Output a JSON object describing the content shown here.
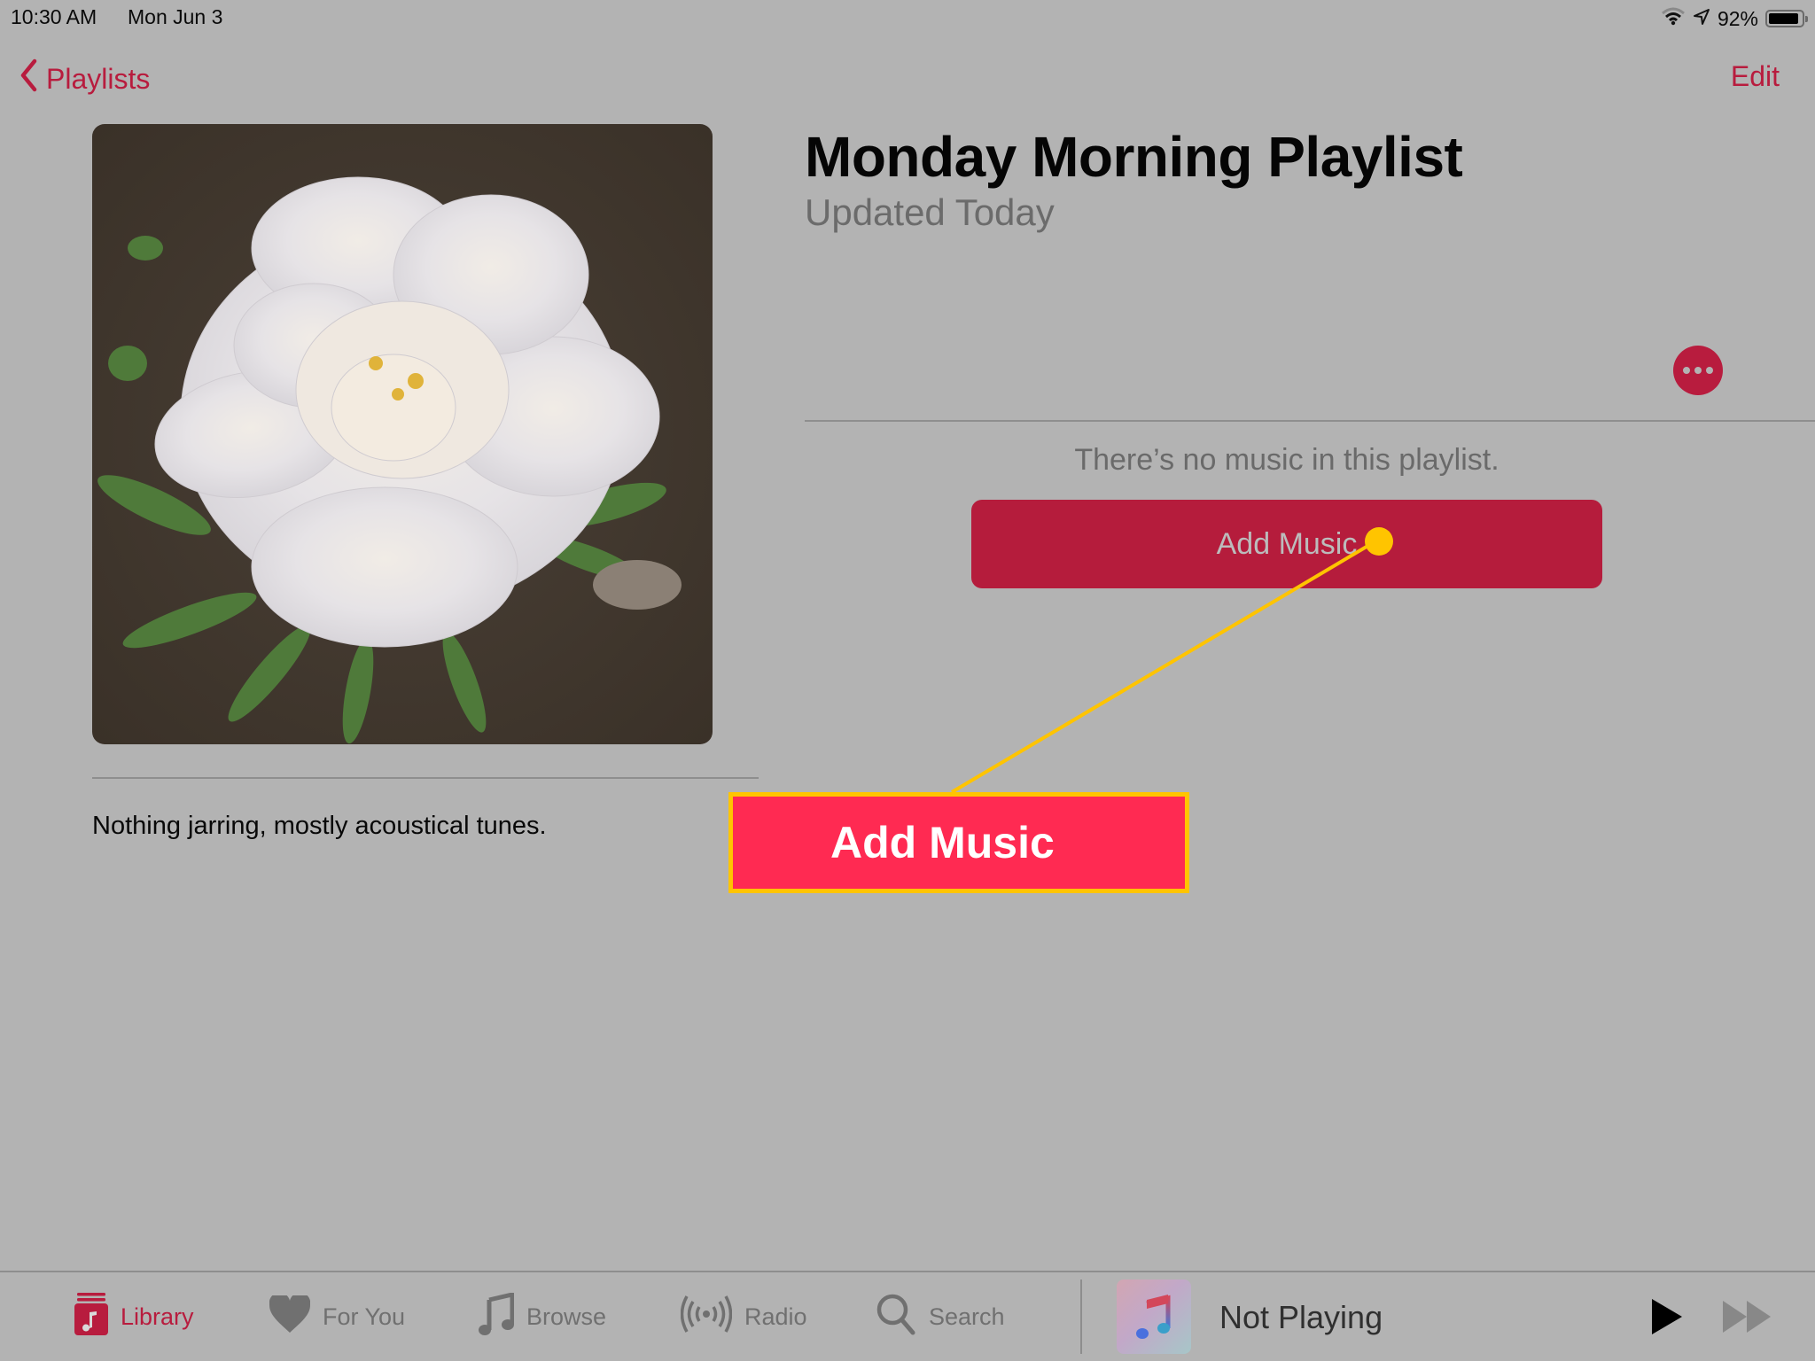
{
  "status_bar": {
    "time": "10:30 AM",
    "date": "Mon Jun 3",
    "battery_percent": "92%",
    "battery_level": 0.92,
    "icons": [
      "wifi-icon",
      "location-arrow-icon",
      "battery-icon"
    ]
  },
  "nav": {
    "back_label": "Playlists",
    "edit_label": "Edit"
  },
  "playlist": {
    "title": "Monday Morning Playlist",
    "subtitle": "Updated Today",
    "artwork": "white peony flower photo",
    "description": "Nothing jarring, mostly acoustical tunes.",
    "empty_message": "There’s no music in this playlist.",
    "add_music_label": "Add Music"
  },
  "annotation": {
    "label": "Add Music",
    "colors": {
      "fill": "#ff2a52",
      "border": "#ffc400",
      "pointer": "#ffc400"
    }
  },
  "tabbar": {
    "tabs": [
      {
        "label": "Library",
        "icon": "library-icon",
        "active": true
      },
      {
        "label": "For You",
        "icon": "heart-icon",
        "active": false
      },
      {
        "label": "Browse",
        "icon": "music-note-icon",
        "active": false
      },
      {
        "label": "Radio",
        "icon": "radio-icon",
        "active": false
      },
      {
        "label": "Search",
        "icon": "search-icon",
        "active": false
      }
    ]
  },
  "now_playing": {
    "label": "Not Playing"
  },
  "colors": {
    "accent": "#b81c3e",
    "background": "#b3b3b3"
  }
}
